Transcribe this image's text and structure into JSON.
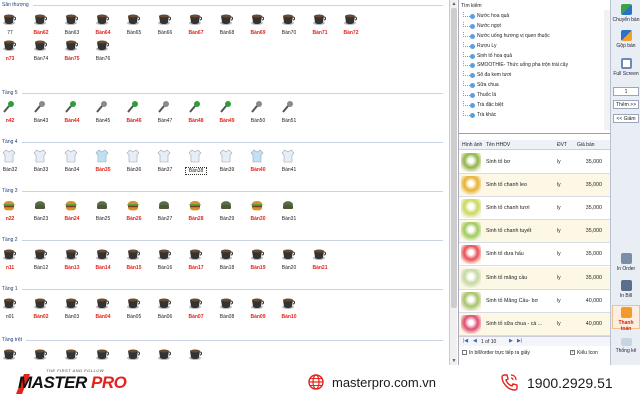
{
  "colors": {
    "busy": "#e3231c",
    "brand_red": "#e3231c",
    "section": "#1f3f7a"
  },
  "sections": [
    {
      "title": "Sân thượng",
      "icon": "coffee-cup",
      "tables": [
        {
          "label": "77",
          "busy": false
        },
        {
          "label": "Bàn62",
          "busy": true
        },
        {
          "label": "Bàn63",
          "busy": false
        },
        {
          "label": "Bàn64",
          "busy": true
        },
        {
          "label": "Bàn65",
          "busy": false
        },
        {
          "label": "Bàn66",
          "busy": false
        },
        {
          "label": "Bàn67",
          "busy": true
        },
        {
          "label": "Bàn68",
          "busy": false
        },
        {
          "label": "Bàn69",
          "busy": true
        },
        {
          "label": "Bàn70",
          "busy": false
        },
        {
          "label": "Bàn71",
          "busy": true
        },
        {
          "label": "Bàn72",
          "busy": true
        },
        {
          "label": "n73",
          "busy": true
        },
        {
          "label": "Bàn74",
          "busy": false
        },
        {
          "label": "Bàn75",
          "busy": true
        },
        {
          "label": "Bàn76",
          "busy": false
        }
      ]
    },
    {
      "title": "Tầng 5",
      "icon": "microphone",
      "tables": [
        {
          "label": "n42",
          "busy": true
        },
        {
          "label": "Bàn43",
          "busy": false
        },
        {
          "label": "Bàn44",
          "busy": true
        },
        {
          "label": "Bàn45",
          "busy": false
        },
        {
          "label": "Bàn46",
          "busy": true
        },
        {
          "label": "Bàn47",
          "busy": false
        },
        {
          "label": "Bàn48",
          "busy": true
        },
        {
          "label": "Bàn49",
          "busy": true
        },
        {
          "label": "Bàn50",
          "busy": false
        },
        {
          "label": "Bàn51",
          "busy": false
        }
      ]
    },
    {
      "title": "Tầng 4",
      "icon": "shirt",
      "tables": [
        {
          "label": "Bàn32",
          "busy": false
        },
        {
          "label": "Bàn33",
          "busy": false
        },
        {
          "label": "Bàn34",
          "busy": false
        },
        {
          "label": "Bàn35",
          "busy": true
        },
        {
          "label": "Bàn36",
          "busy": false
        },
        {
          "label": "Bàn37",
          "busy": false
        },
        {
          "label": "Bàn38",
          "busy": false,
          "selected": true
        },
        {
          "label": "Bàn39",
          "busy": false
        },
        {
          "label": "Bàn40",
          "busy": true
        },
        {
          "label": "Bàn41",
          "busy": false
        }
      ]
    },
    {
      "title": "Tầng 3",
      "icon": "burger",
      "tables": [
        {
          "label": "n22",
          "busy": true
        },
        {
          "label": "Bàn23",
          "busy": false
        },
        {
          "label": "Bàn24",
          "busy": true
        },
        {
          "label": "Bàn25",
          "busy": false
        },
        {
          "label": "Bàn26",
          "busy": true
        },
        {
          "label": "Bàn27",
          "busy": false
        },
        {
          "label": "Bàn28",
          "busy": true
        },
        {
          "label": "Bàn29",
          "busy": false
        },
        {
          "label": "Bàn30",
          "busy": true
        },
        {
          "label": "Bàn31",
          "busy": false
        }
      ]
    },
    {
      "title": "Tầng 2",
      "icon": "coffee-cup",
      "tables": [
        {
          "label": "n11",
          "busy": true
        },
        {
          "label": "Bàn12",
          "busy": false
        },
        {
          "label": "Bàn13",
          "busy": true
        },
        {
          "label": "Bàn14",
          "busy": true
        },
        {
          "label": "Bàn15",
          "busy": true
        },
        {
          "label": "Bàn16",
          "busy": false
        },
        {
          "label": "Bàn17",
          "busy": true
        },
        {
          "label": "Bàn18",
          "busy": false
        },
        {
          "label": "Bàn19",
          "busy": true
        },
        {
          "label": "Bàn20",
          "busy": false
        },
        {
          "label": "Bàn21",
          "busy": true
        }
      ]
    },
    {
      "title": "Tầng 1",
      "icon": "coffee-cup",
      "tables": [
        {
          "label": "n01",
          "busy": false
        },
        {
          "label": "Bàn02",
          "busy": true
        },
        {
          "label": "Bàn03",
          "busy": false
        },
        {
          "label": "Bàn04",
          "busy": true
        },
        {
          "label": "Bàn05",
          "busy": false
        },
        {
          "label": "Bàn06",
          "busy": false
        },
        {
          "label": "Bàn07",
          "busy": true
        },
        {
          "label": "Bàn08",
          "busy": false
        },
        {
          "label": "Bàn09",
          "busy": true
        },
        {
          "label": "Bàn10",
          "busy": true
        }
      ]
    },
    {
      "title": "Tầng trệt",
      "icon": "coffee-cup",
      "tables": [
        {
          "label": "",
          "busy": false
        },
        {
          "label": "",
          "busy": false
        },
        {
          "label": "",
          "busy": false
        },
        {
          "label": "",
          "busy": false
        },
        {
          "label": "",
          "busy": false
        },
        {
          "label": "",
          "busy": false
        },
        {
          "label": "",
          "busy": false
        }
      ]
    }
  ],
  "categories": {
    "header": "Tìm kiếm",
    "items": [
      "Nước hoa quả",
      "Nước ngọt",
      "Nước uống hương vị quen thuộc",
      "Rượu Ly",
      "Sinh tố hoa quả",
      "SMOOTHIE- Thức uống pha trộn trái cây",
      "Sô đa kem tươi",
      "Sữa chua",
      "Thuốc lá",
      "Trà đặc biệt",
      "Trà khác"
    ]
  },
  "products": {
    "headers": {
      "image": "Hình ảnh",
      "name": "Tên HHDV",
      "unit": "ĐVT",
      "price": "Giá bán"
    },
    "rows": [
      {
        "name": "Sinh tố bơ",
        "unit": "ly",
        "price": "35,000",
        "color": "#8fb547"
      },
      {
        "name": "Sinh tố chanh leo",
        "unit": "ly",
        "price": "35,000",
        "color": "#e7b12e"
      },
      {
        "name": "Sinh tố chanh tươi",
        "unit": "ly",
        "price": "35,000",
        "color": "#c9d95b"
      },
      {
        "name": "Sinh tố chanh tuyết",
        "unit": "ly",
        "price": "35,000",
        "color": "#9fca5a"
      },
      {
        "name": "Sinh tố dưa hấu",
        "unit": "ly",
        "price": "35,000",
        "color": "#e94d57"
      },
      {
        "name": "Sinh tố mãng cầu",
        "unit": "ly",
        "price": "35,000",
        "color": "#c5d9a0"
      },
      {
        "name": "Sinh tố Măng Cầu- bơ",
        "unit": "ly",
        "price": "40,000",
        "color": "#a7c26a"
      },
      {
        "name": "Sinh tố sữa chua - cà ...",
        "unit": "ly",
        "price": "40,000",
        "color": "#e14a6e"
      }
    ],
    "pager": "1 of 10",
    "option_bill": "In bill/order trực tiếp ra giấy",
    "option_icon": "Kiểu Icon"
  },
  "tools": {
    "transfer": "Chuyển bàn",
    "merge": "Gộp bàn",
    "fullscreen": "Full Screen",
    "qty": "1",
    "increase": "Thêm >>",
    "decrease": "<< Giảm",
    "print_order": "In Order",
    "print_bill": "In Bill",
    "checkout": "Thanh toán",
    "stats": "Thống kê"
  },
  "footer": {
    "brand_master": "MASTER",
    "brand_pro": "PRO",
    "slogan": "THE FIRST AND FOLLOW",
    "website": "masterpro.com.vn",
    "phone": "1900.2929.51"
  }
}
